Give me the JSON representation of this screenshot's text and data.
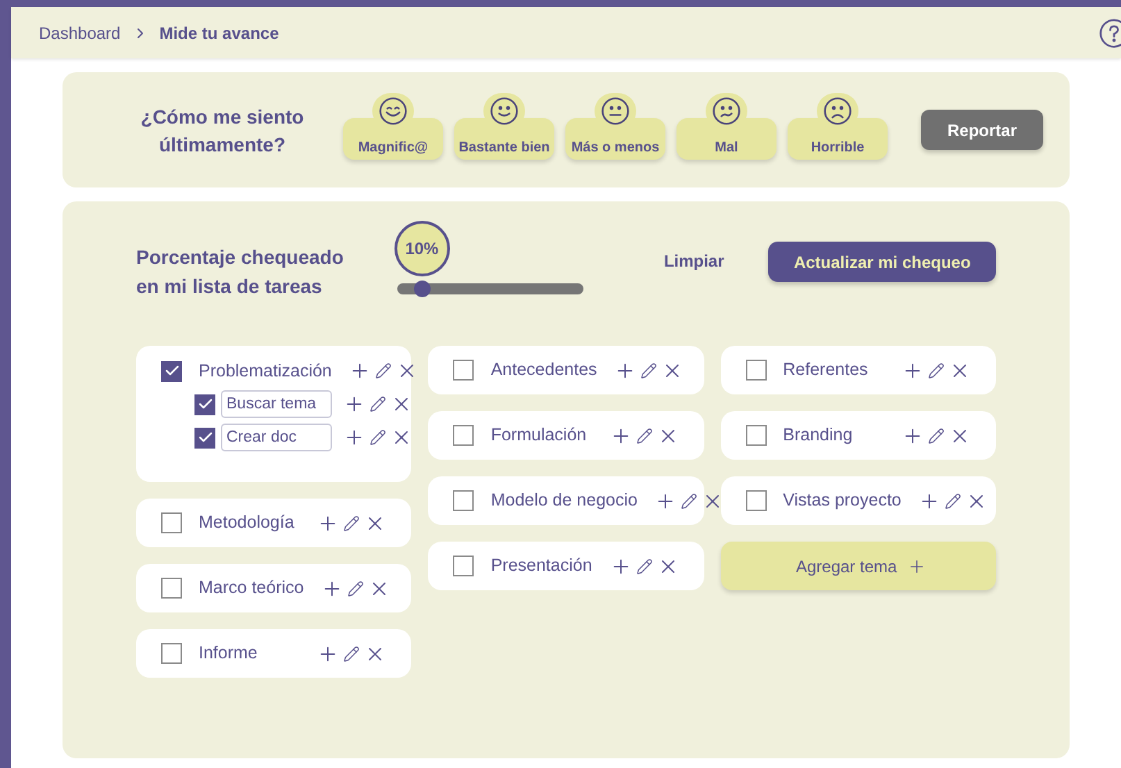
{
  "breadcrumb": {
    "items": [
      "Dashboard",
      "Mide tu avance"
    ]
  },
  "mood": {
    "question": "¿Cómo me siento últimamente?",
    "options": [
      {
        "label": "Magnific@",
        "kind": "great"
      },
      {
        "label": "Bastante bien",
        "kind": "good"
      },
      {
        "label": "Más o menos",
        "kind": "neutral"
      },
      {
        "label": "Mal",
        "kind": "bad"
      },
      {
        "label": "Horrible",
        "kind": "awful"
      }
    ],
    "button": "Reportar"
  },
  "progress": {
    "title": "Porcentaje chequeado en mi lista de tareas",
    "reading": "10%",
    "level": 0.1,
    "clear": "Limpiar",
    "button": "Actualizar mi chequeo"
  },
  "columns": [
    [
      {
        "label": "Problematización",
        "checked": true,
        "children": [
          {
            "value": "Buscar tema",
            "checked": true
          },
          {
            "value": "Crear doc",
            "checked": true
          }
        ]
      },
      {
        "label": "Metodología",
        "checked": false
      },
      {
        "label": "Marco teórico",
        "checked": false
      },
      {
        "label": "Informe",
        "checked": false
      }
    ],
    [
      {
        "label": "Antecedentes",
        "checked": false
      },
      {
        "label": "Formulación",
        "checked": false
      },
      {
        "label": "Modelo de negocio",
        "checked": false
      },
      {
        "label": "Presentación",
        "checked": false
      }
    ],
    [
      {
        "label": "Referentes",
        "checked": false
      },
      {
        "label": "Branding",
        "checked": false
      },
      {
        "label": "Vistas proyecto",
        "checked": false
      }
    ]
  ],
  "add_topic": "Agregar tema"
}
